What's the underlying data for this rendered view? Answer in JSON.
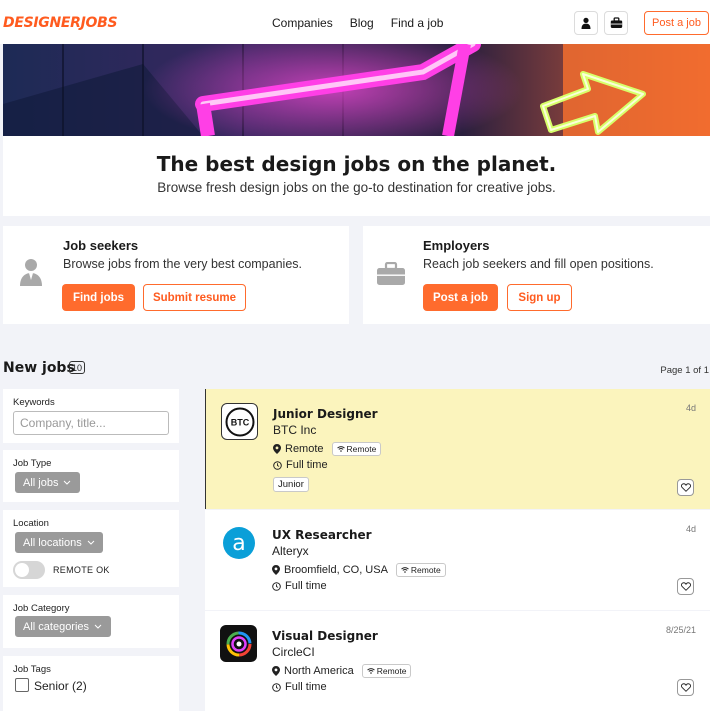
{
  "header": {
    "logo": "DESIGNERJOBS",
    "nav": [
      "Companies",
      "Blog",
      "Find a job"
    ],
    "post_job": "Post a job"
  },
  "hero": {
    "title": "The best design jobs on the planet.",
    "subtitle": "Browse fresh design jobs on the go-to destination for creative jobs."
  },
  "seekers": {
    "title": "Job seekers",
    "text": "Browse jobs from the very best companies.",
    "primary": "Find jobs",
    "secondary": "Submit resume"
  },
  "employers": {
    "title": "Employers",
    "text": "Reach job seekers and fill open positions.",
    "primary": "Post a job",
    "secondary": "Sign up"
  },
  "jobs_header": {
    "title": "New jobs",
    "count": "10",
    "page": "Page 1 of 1"
  },
  "filters": {
    "keywords": {
      "label": "Keywords",
      "placeholder": "Company, title..."
    },
    "job_type": {
      "label": "Job Type",
      "value": "All jobs"
    },
    "location": {
      "label": "Location",
      "value": "All locations",
      "remote_label": "REMOTE OK"
    },
    "category": {
      "label": "Job Category",
      "value": "All categories"
    },
    "tags": {
      "label": "Job Tags",
      "first": "Senior (2)"
    }
  },
  "jobs": [
    {
      "title": "Junior Designer",
      "company": "BTC Inc",
      "location": "Remote",
      "remote": "Remote",
      "type": "Full time",
      "tag": "Junior",
      "date": "4d",
      "logo": "BTC"
    },
    {
      "title": "UX Researcher",
      "company": "Alteryx",
      "location": "Broomfield, CO, USA",
      "remote": "Remote",
      "type": "Full time",
      "date": "4d",
      "logo": "a"
    },
    {
      "title": "Visual Designer",
      "company": "CircleCI",
      "location": "North America",
      "remote": "Remote",
      "type": "Full time",
      "date": "8/25/21"
    }
  ],
  "colors": {
    "accent": "#ff6b2d",
    "featured_bg": "#fbf4bd"
  }
}
